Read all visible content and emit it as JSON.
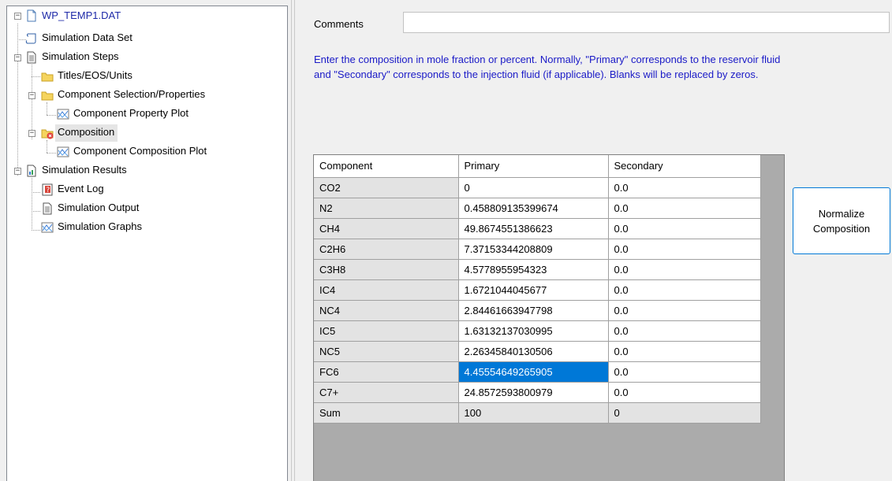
{
  "tree": {
    "root": "WP_TEMP1.DAT",
    "simulation_data_set": "Simulation Data Set",
    "simulation_steps": "Simulation Steps",
    "titles_eos_units": "Titles/EOS/Units",
    "component_selection": "Component Selection/Properties",
    "component_property_plot": "Component Property Plot",
    "composition": "Composition",
    "component_composition_plot": "Component Composition Plot",
    "simulation_results": "Simulation Results",
    "event_log": "Event Log",
    "simulation_output": "Simulation Output",
    "simulation_graphs": "Simulation Graphs"
  },
  "comments": {
    "label": "Comments",
    "value": ""
  },
  "instructions": {
    "line1": "Enter the composition in mole fraction or percent.  Normally, \"Primary\" corresponds to the reservoir fluid",
    "line2": "and \"Secondary\" corresponds to the injection fluid (if applicable). Blanks will be replaced by zeros."
  },
  "grid": {
    "headers": [
      "Component",
      "Primary",
      "Secondary"
    ],
    "rows": [
      [
        "CO2",
        "0",
        "0.0"
      ],
      [
        "N2",
        "0.458809135399674",
        "0.0"
      ],
      [
        "CH4",
        "49.8674551386623",
        "0.0"
      ],
      [
        "C2H6",
        "7.37153344208809",
        "0.0"
      ],
      [
        "C3H8",
        "4.5778955954323",
        "0.0"
      ],
      [
        "IC4",
        "1.6721044045677",
        "0.0"
      ],
      [
        "NC4",
        "2.84461663947798",
        "0.0"
      ],
      [
        "IC5",
        "1.63132137030995",
        "0.0"
      ],
      [
        "NC5",
        "2.26345840130506",
        "0.0"
      ],
      [
        "FC6",
        "4.45554649265905",
        "0.0"
      ],
      [
        "C7+",
        "24.8572593800979",
        "0.0"
      ]
    ],
    "sum": [
      "Sum",
      "100",
      "0"
    ],
    "selected_row": 9
  },
  "normalize_button": {
    "line1": "Normalize",
    "line2": "Composition"
  },
  "colors": {
    "instruction_text": "#1a1ac7",
    "selection": "#0078d7",
    "button_border": "#0078d7"
  }
}
